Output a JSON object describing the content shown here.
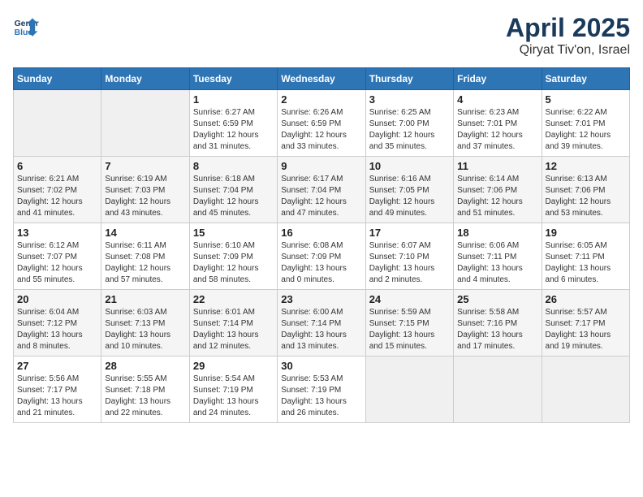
{
  "header": {
    "logo_line1": "General",
    "logo_line2": "Blue",
    "title": "April 2025",
    "subtitle": "Qiryat Tiv'on, Israel"
  },
  "days_of_week": [
    "Sunday",
    "Monday",
    "Tuesday",
    "Wednesday",
    "Thursday",
    "Friday",
    "Saturday"
  ],
  "weeks": [
    [
      {
        "day": "",
        "info": ""
      },
      {
        "day": "",
        "info": ""
      },
      {
        "day": "1",
        "info": "Sunrise: 6:27 AM\nSunset: 6:59 PM\nDaylight: 12 hours\nand 31 minutes."
      },
      {
        "day": "2",
        "info": "Sunrise: 6:26 AM\nSunset: 6:59 PM\nDaylight: 12 hours\nand 33 minutes."
      },
      {
        "day": "3",
        "info": "Sunrise: 6:25 AM\nSunset: 7:00 PM\nDaylight: 12 hours\nand 35 minutes."
      },
      {
        "day": "4",
        "info": "Sunrise: 6:23 AM\nSunset: 7:01 PM\nDaylight: 12 hours\nand 37 minutes."
      },
      {
        "day": "5",
        "info": "Sunrise: 6:22 AM\nSunset: 7:01 PM\nDaylight: 12 hours\nand 39 minutes."
      }
    ],
    [
      {
        "day": "6",
        "info": "Sunrise: 6:21 AM\nSunset: 7:02 PM\nDaylight: 12 hours\nand 41 minutes."
      },
      {
        "day": "7",
        "info": "Sunrise: 6:19 AM\nSunset: 7:03 PM\nDaylight: 12 hours\nand 43 minutes."
      },
      {
        "day": "8",
        "info": "Sunrise: 6:18 AM\nSunset: 7:04 PM\nDaylight: 12 hours\nand 45 minutes."
      },
      {
        "day": "9",
        "info": "Sunrise: 6:17 AM\nSunset: 7:04 PM\nDaylight: 12 hours\nand 47 minutes."
      },
      {
        "day": "10",
        "info": "Sunrise: 6:16 AM\nSunset: 7:05 PM\nDaylight: 12 hours\nand 49 minutes."
      },
      {
        "day": "11",
        "info": "Sunrise: 6:14 AM\nSunset: 7:06 PM\nDaylight: 12 hours\nand 51 minutes."
      },
      {
        "day": "12",
        "info": "Sunrise: 6:13 AM\nSunset: 7:06 PM\nDaylight: 12 hours\nand 53 minutes."
      }
    ],
    [
      {
        "day": "13",
        "info": "Sunrise: 6:12 AM\nSunset: 7:07 PM\nDaylight: 12 hours\nand 55 minutes."
      },
      {
        "day": "14",
        "info": "Sunrise: 6:11 AM\nSunset: 7:08 PM\nDaylight: 12 hours\nand 57 minutes."
      },
      {
        "day": "15",
        "info": "Sunrise: 6:10 AM\nSunset: 7:09 PM\nDaylight: 12 hours\nand 58 minutes."
      },
      {
        "day": "16",
        "info": "Sunrise: 6:08 AM\nSunset: 7:09 PM\nDaylight: 13 hours\nand 0 minutes."
      },
      {
        "day": "17",
        "info": "Sunrise: 6:07 AM\nSunset: 7:10 PM\nDaylight: 13 hours\nand 2 minutes."
      },
      {
        "day": "18",
        "info": "Sunrise: 6:06 AM\nSunset: 7:11 PM\nDaylight: 13 hours\nand 4 minutes."
      },
      {
        "day": "19",
        "info": "Sunrise: 6:05 AM\nSunset: 7:11 PM\nDaylight: 13 hours\nand 6 minutes."
      }
    ],
    [
      {
        "day": "20",
        "info": "Sunrise: 6:04 AM\nSunset: 7:12 PM\nDaylight: 13 hours\nand 8 minutes."
      },
      {
        "day": "21",
        "info": "Sunrise: 6:03 AM\nSunset: 7:13 PM\nDaylight: 13 hours\nand 10 minutes."
      },
      {
        "day": "22",
        "info": "Sunrise: 6:01 AM\nSunset: 7:14 PM\nDaylight: 13 hours\nand 12 minutes."
      },
      {
        "day": "23",
        "info": "Sunrise: 6:00 AM\nSunset: 7:14 PM\nDaylight: 13 hours\nand 13 minutes."
      },
      {
        "day": "24",
        "info": "Sunrise: 5:59 AM\nSunset: 7:15 PM\nDaylight: 13 hours\nand 15 minutes."
      },
      {
        "day": "25",
        "info": "Sunrise: 5:58 AM\nSunset: 7:16 PM\nDaylight: 13 hours\nand 17 minutes."
      },
      {
        "day": "26",
        "info": "Sunrise: 5:57 AM\nSunset: 7:17 PM\nDaylight: 13 hours\nand 19 minutes."
      }
    ],
    [
      {
        "day": "27",
        "info": "Sunrise: 5:56 AM\nSunset: 7:17 PM\nDaylight: 13 hours\nand 21 minutes."
      },
      {
        "day": "28",
        "info": "Sunrise: 5:55 AM\nSunset: 7:18 PM\nDaylight: 13 hours\nand 22 minutes."
      },
      {
        "day": "29",
        "info": "Sunrise: 5:54 AM\nSunset: 7:19 PM\nDaylight: 13 hours\nand 24 minutes."
      },
      {
        "day": "30",
        "info": "Sunrise: 5:53 AM\nSunset: 7:19 PM\nDaylight: 13 hours\nand 26 minutes."
      },
      {
        "day": "",
        "info": ""
      },
      {
        "day": "",
        "info": ""
      },
      {
        "day": "",
        "info": ""
      }
    ]
  ]
}
